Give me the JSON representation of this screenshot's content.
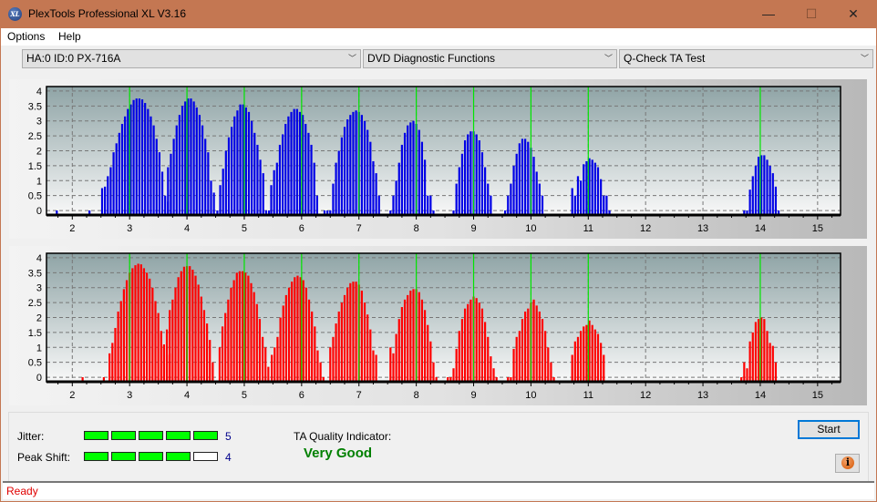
{
  "window": {
    "title": "PlexTools Professional XL V3.16",
    "icon_label": "XL",
    "controls": {
      "minimize": "—",
      "maximize": "☐",
      "close": "✕"
    }
  },
  "menu": [
    "Options",
    "Help"
  ],
  "toolbar": {
    "drive": "HA:0 ID:0  PX-716A",
    "function": "DVD Diagnostic Functions",
    "test": "Q-Check TA Test"
  },
  "colors": {
    "lands_bars": "#0000e6",
    "pits_bars": "#ff0000",
    "reference_lines": "#00e600",
    "meter_on": "#00ff00",
    "quality_text": "#008000",
    "status_text": "#e00000"
  },
  "chart_data": [
    {
      "type": "bar",
      "name": "top-chart",
      "series_color": "#0000e6",
      "x_ticks": [
        2,
        3,
        4,
        5,
        6,
        7,
        8,
        9,
        10,
        11,
        12,
        13,
        14,
        15
      ],
      "y_ticks": [
        "0",
        "0.5",
        "1",
        "1.5",
        "2",
        "2.5",
        "3",
        "3.5",
        "4"
      ],
      "xlim": [
        1.55,
        15.4
      ],
      "ylim": [
        -0.15,
        4.15
      ],
      "reference_lines": [
        3,
        4,
        5,
        6,
        7,
        8,
        9,
        10,
        11,
        14
      ],
      "grid": true,
      "clusters": [
        {
          "start": 1.73,
          "values": [
            0
          ]
        },
        {
          "start": 2.3,
          "values": [
            0
          ]
        },
        {
          "start": 2.52,
          "values": [
            0.75,
            0.8,
            1.15,
            1.45,
            1.95,
            2.25,
            2.6,
            2.9,
            3.15,
            3.4,
            3.55,
            3.7,
            3.75,
            3.75,
            3.72,
            3.6,
            3.4,
            3.15,
            2.85,
            2.4,
            1.95,
            1.3,
            0.5,
            0.3,
            0.7
          ]
        },
        {
          "start": 3.67,
          "values": [
            1.45,
            1.9,
            2.4,
            2.85,
            3.2,
            3.5,
            3.65,
            3.75,
            3.75,
            3.65,
            3.45,
            3.2,
            2.85,
            2.4,
            1.95,
            1.0,
            0.6
          ]
        },
        {
          "start": 4.53,
          "values": [
            0,
            0.85,
            1.4,
            2.0,
            2.45,
            2.8,
            3.15,
            3.35,
            3.55,
            3.55,
            3.45,
            3.3,
            3.0,
            2.6,
            2.2,
            1.7,
            1.25,
            0,
            0
          ]
        },
        {
          "start": 5.47,
          "values": [
            0.85,
            1.35,
            1.6,
            2.2,
            2.55,
            2.9,
            3.15,
            3.3,
            3.4,
            3.4,
            3.3,
            3.2,
            2.9,
            2.6,
            2.2,
            1.6,
            0.5
          ]
        },
        {
          "start": 6.4,
          "values": [
            0,
            0,
            0,
            0.9,
            1.6,
            2.0,
            2.45,
            2.8,
            3.05,
            3.2,
            3.3,
            3.35,
            3.3,
            3.2,
            3.0,
            2.7,
            2.3,
            1.65,
            1.25,
            0.5
          ]
        },
        {
          "start": 7.55,
          "values": [
            0,
            0.5,
            1.0,
            1.6,
            2.2,
            2.6,
            2.85,
            2.95,
            3.0,
            2.9,
            2.7,
            2.3,
            1.7,
            0.5,
            0.5,
            0
          ]
        },
        {
          "start": 8.65,
          "values": [
            0,
            0.9,
            1.45,
            1.9,
            2.35,
            2.55,
            2.65,
            2.65,
            2.55,
            2.35,
            1.95,
            1.45,
            0.9,
            0.5
          ]
        },
        {
          "start": 9.55,
          "values": [
            0,
            0.5,
            0.9,
            1.5,
            1.9,
            2.25,
            2.4,
            2.4,
            2.3,
            2.1,
            1.8,
            1.3,
            0.9,
            0.5
          ]
        },
        {
          "start": 10.72,
          "values": [
            0.75,
            0.5,
            1.15,
            1.0,
            1.55,
            1.65,
            1.75,
            1.7,
            1.6,
            1.45,
            1.05,
            0.5,
            0.5,
            0
          ]
        },
        {
          "start": 13.72,
          "values": [
            0,
            0,
            0.7,
            1.15,
            1.5,
            1.8,
            1.85,
            1.85,
            1.7,
            1.5,
            1.25,
            0.8,
            0
          ]
        }
      ]
    },
    {
      "type": "bar",
      "name": "bottom-chart",
      "series_color": "#ff0000",
      "x_ticks": [
        2,
        3,
        4,
        5,
        6,
        7,
        8,
        9,
        10,
        11,
        12,
        13,
        14,
        15
      ],
      "y_ticks": [
        "0",
        "0.5",
        "1",
        "1.5",
        "2",
        "2.5",
        "3",
        "3.5",
        "4"
      ],
      "xlim": [
        1.55,
        15.4
      ],
      "ylim": [
        -0.15,
        4.15
      ],
      "reference_lines": [
        3,
        4,
        5,
        6,
        7,
        8,
        9,
        10,
        11,
        14
      ],
      "grid": true,
      "clusters": [
        {
          "start": 2.18,
          "values": [
            0
          ]
        },
        {
          "start": 2.55,
          "values": [
            0
          ]
        },
        {
          "start": 2.65,
          "values": [
            0.8,
            1.15,
            1.65,
            2.2,
            2.55,
            2.95,
            3.25,
            3.5,
            3.65,
            3.75,
            3.8,
            3.78,
            3.65,
            3.5,
            3.3,
            3.0,
            2.55,
            2.15,
            1.55,
            1.1,
            0.75,
            0.8
          ]
        },
        {
          "start": 3.6,
          "values": [
            1.05,
            1.6,
            2.25,
            2.6,
            3.0,
            3.35,
            3.55,
            3.7,
            3.72,
            3.72,
            3.6,
            3.4,
            3.1,
            2.7,
            2.25,
            1.8,
            1.25,
            0.5
          ]
        },
        {
          "start": 4.57,
          "values": [
            1.0,
            1.7,
            2.15,
            2.6,
            3.0,
            3.25,
            3.5,
            3.55,
            3.55,
            3.5,
            3.4,
            3.15,
            2.85,
            2.45,
            1.95,
            1.35,
            1.0,
            0.35
          ]
        },
        {
          "start": 5.48,
          "values": [
            0.75,
            1.0,
            1.35,
            2.0,
            2.4,
            2.75,
            3.0,
            3.2,
            3.35,
            3.4,
            3.35,
            3.25,
            3.0,
            2.6,
            2.2,
            1.7,
            0.9,
            0.5,
            0
          ]
        },
        {
          "start": 6.5,
          "values": [
            1.0,
            1.35,
            1.8,
            2.2,
            2.5,
            2.75,
            3.0,
            3.15,
            3.2,
            3.2,
            3.1,
            2.9,
            2.5,
            2.1,
            1.6,
            0.9,
            0.75
          ]
        },
        {
          "start": 7.55,
          "values": [
            1.0,
            0.8,
            1.45,
            1.95,
            2.35,
            2.6,
            2.75,
            2.9,
            2.95,
            2.95,
            2.85,
            2.6,
            2.25,
            1.75,
            1.2,
            0.5,
            0
          ]
        },
        {
          "start": 8.55,
          "values": [
            0,
            0,
            0.3,
            0.95,
            1.55,
            1.95,
            2.3,
            2.45,
            2.6,
            2.7,
            2.65,
            2.5,
            2.3,
            1.85,
            1.35,
            0.7,
            0.3,
            0
          ]
        },
        {
          "start": 9.6,
          "values": [
            0,
            0,
            0.95,
            1.35,
            1.55,
            1.95,
            2.2,
            2.3,
            2.5,
            2.6,
            2.4,
            2.2,
            1.95,
            1.55,
            1.0,
            0.5,
            0
          ]
        },
        {
          "start": 10.72,
          "values": [
            0.75,
            1.2,
            1.35,
            1.55,
            1.7,
            1.75,
            1.9,
            1.75,
            1.6,
            1.45,
            1.15,
            0.75
          ]
        },
        {
          "start": 13.67,
          "values": [
            0,
            0.5,
            0.3,
            1.2,
            1.5,
            1.85,
            1.95,
            2.0,
            1.95,
            1.55,
            1.15,
            1.05,
            0.5
          ]
        }
      ]
    }
  ],
  "bottom_panel": {
    "jitter": {
      "label": "Jitter:",
      "value": 5,
      "max": 5
    },
    "peak_shift": {
      "label": "Peak Shift:",
      "value": 4,
      "max": 5
    },
    "ta_label": "TA Quality Indicator:",
    "ta_value": "Very Good",
    "start_label": "Start",
    "info_label": "i"
  },
  "status": "Ready"
}
